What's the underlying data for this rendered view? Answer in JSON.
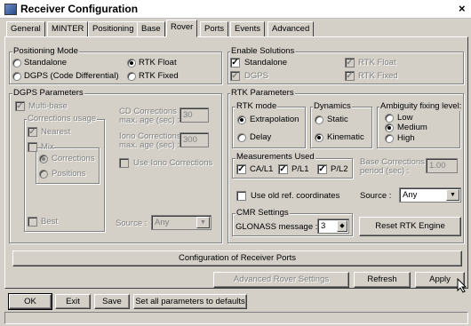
{
  "window": {
    "title": "Receiver Configuration",
    "close_glyph": "×",
    "icon": "app-icon"
  },
  "tabs": [
    {
      "label": "General"
    },
    {
      "label": "MINTER"
    },
    {
      "label": "Positioning"
    },
    {
      "label": "Base"
    },
    {
      "label": "Rover",
      "active": true
    },
    {
      "label": "Ports"
    },
    {
      "label": "Events"
    },
    {
      "label": "Advanced"
    }
  ],
  "positioning_mode": {
    "label": "Positioning Mode",
    "standalone": "Standalone",
    "rtk_float": "RTK Float",
    "dgps": "DGPS (Code Differential)",
    "rtk_fixed": "RTK Fixed",
    "selected": "rtk_float"
  },
  "enable_solutions": {
    "label": "Enable Solutions",
    "standalone": "Standalone",
    "rtk_float": "RTK Float",
    "dgps": "DGPS",
    "rtk_fixed": "RTK Fixed"
  },
  "dgps_params": {
    "label": "DGPS Parameters",
    "multibase": "Multi-base",
    "corrections_usage": "Corrections usage",
    "nearest": "Nearest",
    "mix": "Mix",
    "corrections": "Corrections",
    "positions": "Positions",
    "best": "Best",
    "cd_label_1": "CD Corrections",
    "cd_label_2": "max. age (sec) :",
    "cd_value": "30",
    "iono_label_1": "Iono Corrections",
    "iono_label_2": "max. age (sec) :",
    "iono_value": "300",
    "use_iono": "Use Iono Corrections",
    "source_label": "Source :",
    "source_value": "Any"
  },
  "rtk_params": {
    "label": "RTK Parameters",
    "rtk_mode": "RTK mode",
    "extrapolation": "Extrapolation",
    "delay": "Delay",
    "dynamics": "Dynamics",
    "static": "Static",
    "kinematic": "Kinematic",
    "ambiguity": "Ambiguity fixing level:",
    "low": "Low",
    "medium": "Medium",
    "high": "High",
    "measurements_used": "Measurements Used",
    "ca_l1": "CA/L1",
    "p_l1": "P/L1",
    "p_l2": "P/L2",
    "base_corr_1": "Base Corrections",
    "base_corr_2": "period (sec) :",
    "base_corr_value": "1.00",
    "use_old_ref": "Use old ref. coordinates",
    "source_label": "Source :",
    "source_value": "Any",
    "cmr_settings": "CMR Settings",
    "glonass_label": "GLONASS message :",
    "glonass_value": "3",
    "reset_rtk": "Reset RTK Engine"
  },
  "buttons": {
    "config_ports": "Configuration of Receiver Ports",
    "advanced_rover": "Advanced Rover Settings",
    "refresh": "Refresh",
    "apply": "Apply",
    "ok": "OK",
    "exit": "Exit",
    "save": "Save",
    "defaults": "Set all parameters to defaults"
  },
  "glyphs": {
    "check": "✓",
    "dropdown": "▼",
    "spin": "◆"
  },
  "colors": {
    "window_bg": "#d4d0c8",
    "disabled_text": "#808080"
  }
}
